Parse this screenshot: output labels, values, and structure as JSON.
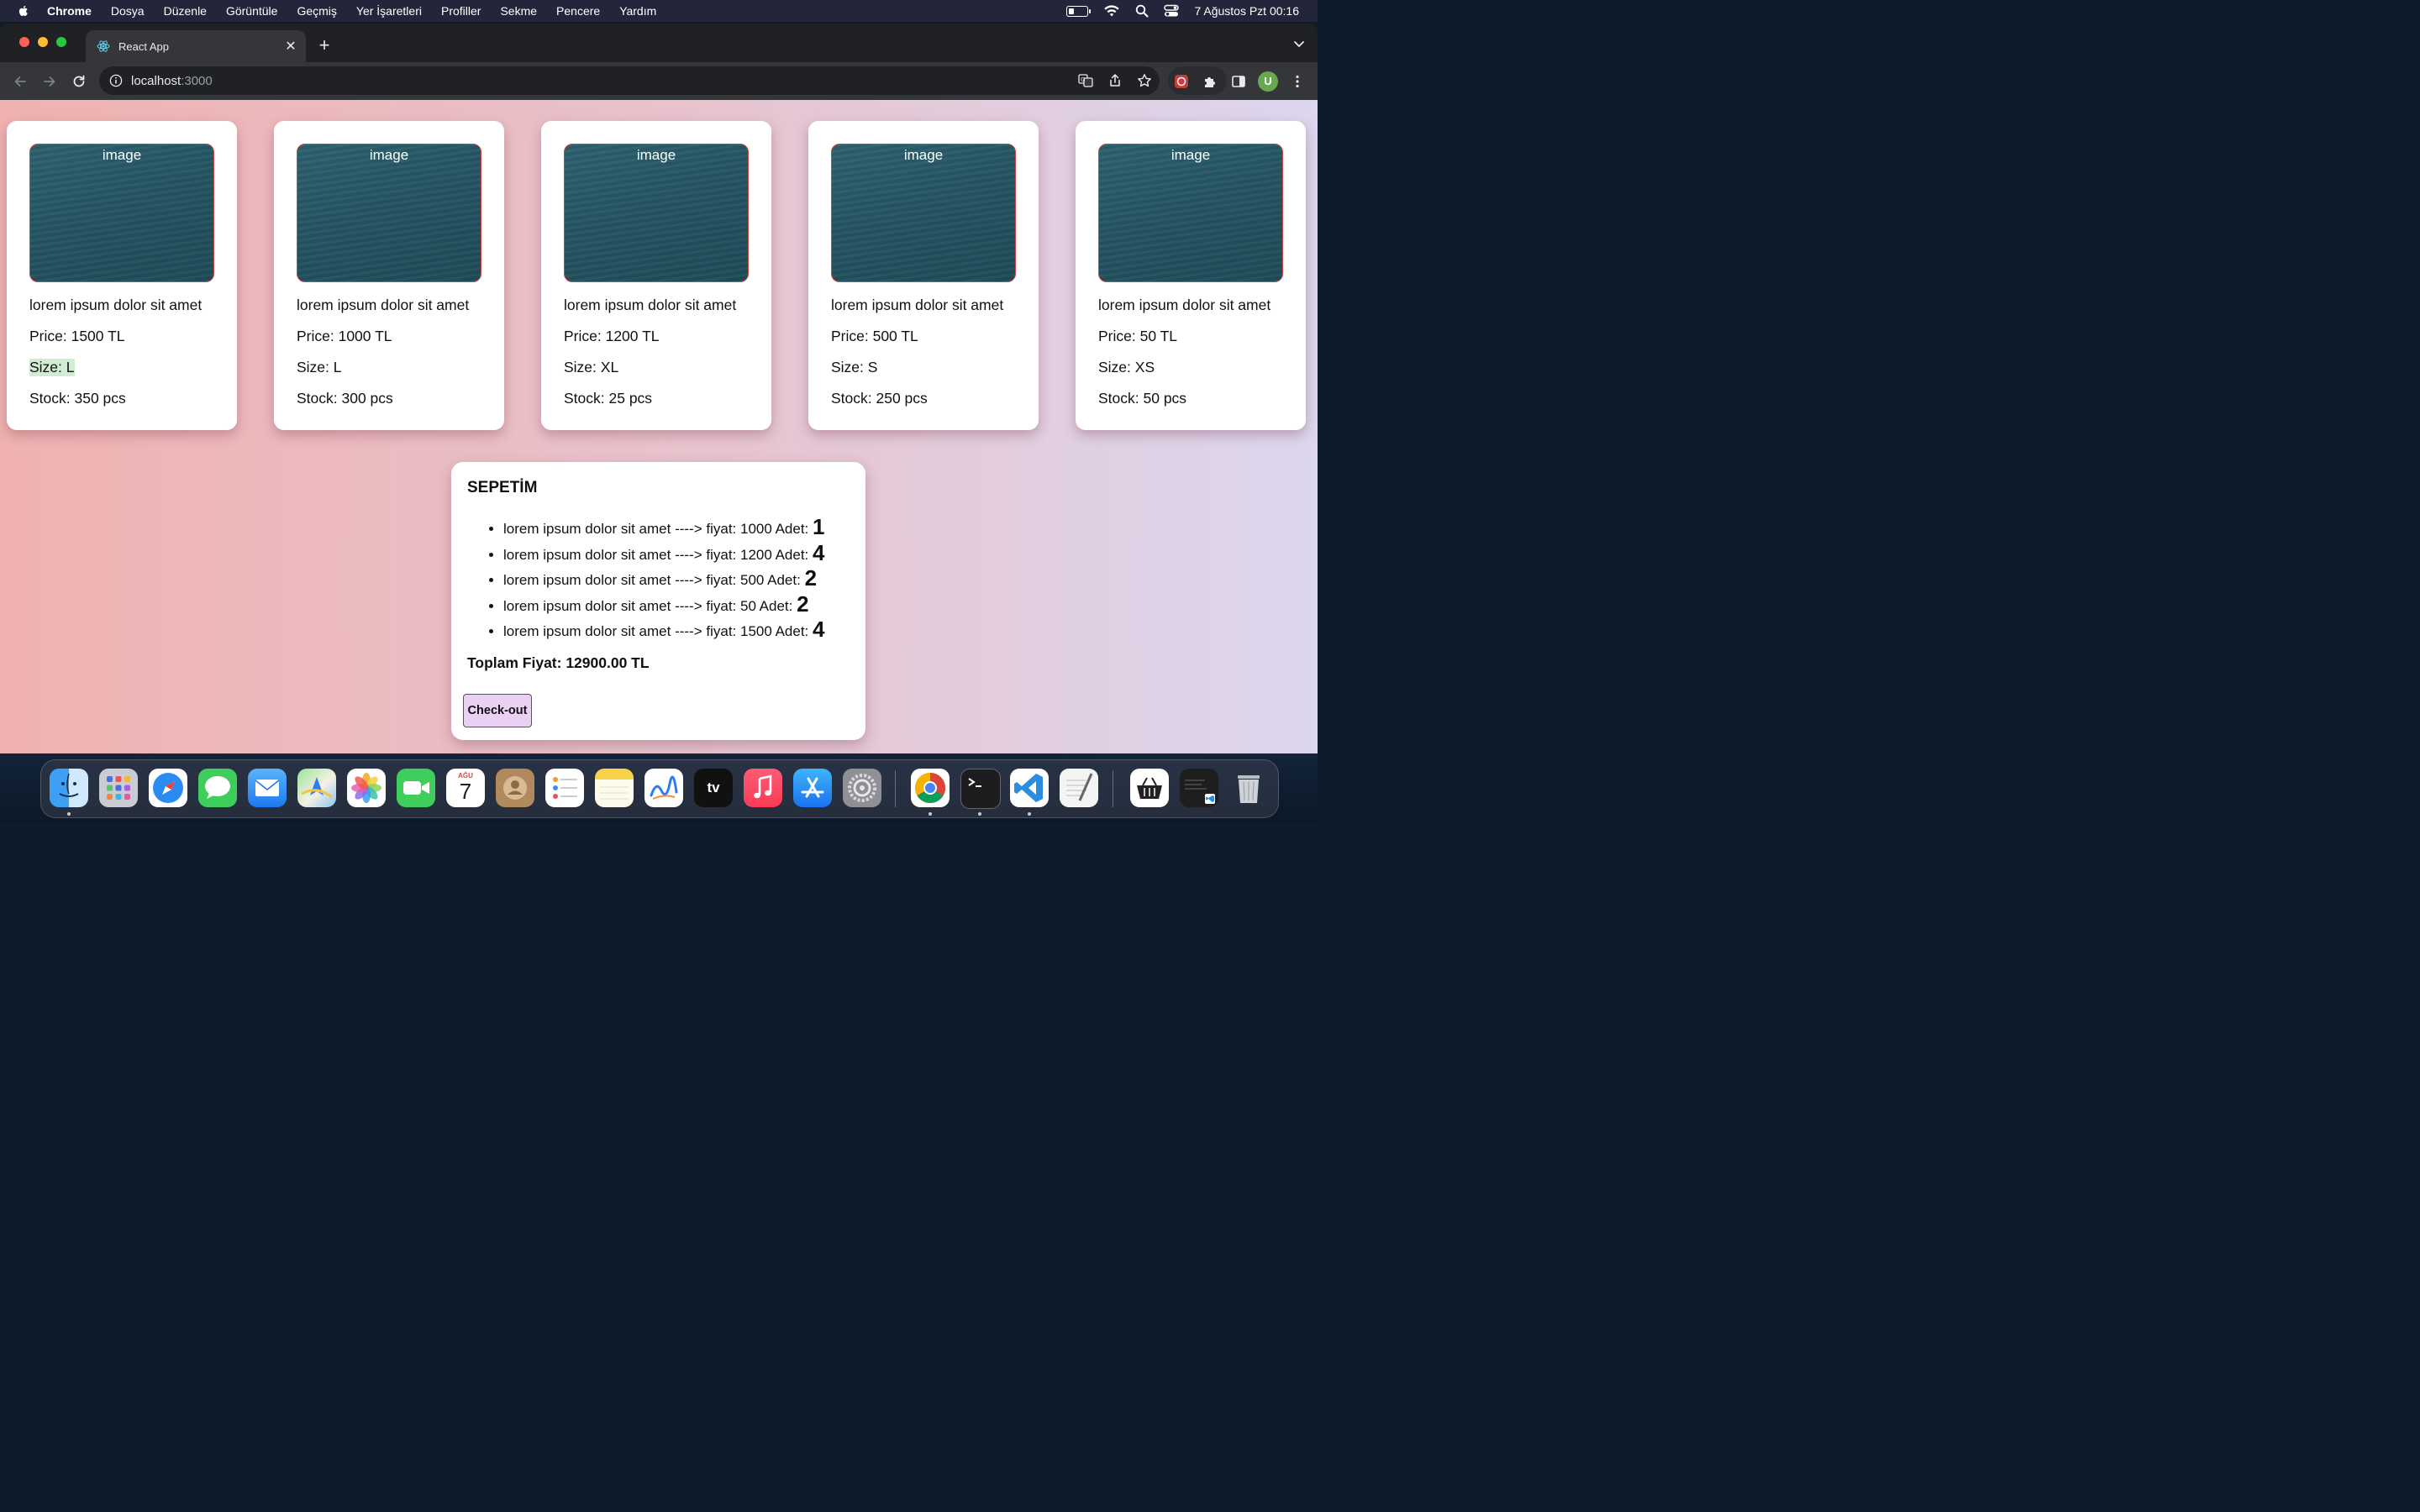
{
  "menubar": {
    "app_name": "Chrome",
    "items": [
      "Dosya",
      "Düzenle",
      "Görüntüle",
      "Geçmiş",
      "Yer İşaretleri",
      "Profiller",
      "Sekme",
      "Pencere",
      "Yardım"
    ],
    "clock": "7 Ağustos Pzt  00:16",
    "icons": [
      "apple-icon",
      "battery-icon",
      "wifi-icon",
      "spotlight-search-icon",
      "control-center-icon"
    ]
  },
  "browser": {
    "tab_title": "React App",
    "tab_favicon": "react-logo-icon",
    "url_host": "localhost",
    "url_port": ":3000",
    "avatar_letter": "U",
    "avatar_color": "#6aa84f"
  },
  "products": [
    {
      "image_label": "image",
      "name": "lorem ipsum dolor sit amet",
      "price": "Price: 1500 TL",
      "size": "Size: L",
      "stock": "Stock: 350 pcs"
    },
    {
      "image_label": "image",
      "name": "lorem ipsum dolor sit amet",
      "price": "Price: 1000 TL",
      "size": "Size: L",
      "stock": "Stock: 300 pcs"
    },
    {
      "image_label": "image",
      "name": "lorem ipsum dolor sit amet",
      "price": "Price: 1200 TL",
      "size": "Size: XL",
      "stock": "Stock: 25 pcs"
    },
    {
      "image_label": "image",
      "name": "lorem ipsum dolor sit amet",
      "price": "Price: 500 TL",
      "size": "Size: S",
      "stock": "Stock: 250 pcs"
    },
    {
      "image_label": "image",
      "name": "lorem ipsum dolor sit amet",
      "price": "Price: 50 TL",
      "size": "Size: XS",
      "stock": "Stock: 50 pcs"
    }
  ],
  "cart": {
    "title": "SEPETİM",
    "items": [
      {
        "text": "lorem ipsum dolor sit amet ----> fiyat: 1000 Adet: ",
        "qty": "1"
      },
      {
        "text": "lorem ipsum dolor sit amet ----> fiyat: 1200 Adet: ",
        "qty": "4"
      },
      {
        "text": "lorem ipsum dolor sit amet ----> fiyat: 500 Adet: ",
        "qty": "2"
      },
      {
        "text": "lorem ipsum dolor sit amet ----> fiyat: 50 Adet: ",
        "qty": "2"
      },
      {
        "text": "lorem ipsum dolor sit amet ----> fiyat: 1500 Adet: ",
        "qty": "4"
      }
    ],
    "total": "Toplam Fiyat: 12900.00 TL",
    "checkout_label": "Check-out",
    "checkout_color": "#ead0f2"
  },
  "dock": {
    "apps": [
      "finder-icon",
      "launchpad-icon",
      "safari-icon",
      "messages-icon",
      "mail-icon",
      "maps-icon",
      "photos-icon",
      "facetime-icon",
      "calendar-icon",
      "contacts-icon",
      "reminders-icon",
      "notes-icon",
      "freeform-icon",
      "apple-tv-icon",
      "music-icon",
      "app-store-icon",
      "system-settings-icon",
      "chrome-icon",
      "terminal-icon",
      "vscode-icon",
      "textedit-icon",
      "basket-app-icon",
      "vscode-window-preview-icon",
      "trash-icon"
    ],
    "calendar_month": "AĞU",
    "calendar_day": "7",
    "tv_label": "tv"
  }
}
